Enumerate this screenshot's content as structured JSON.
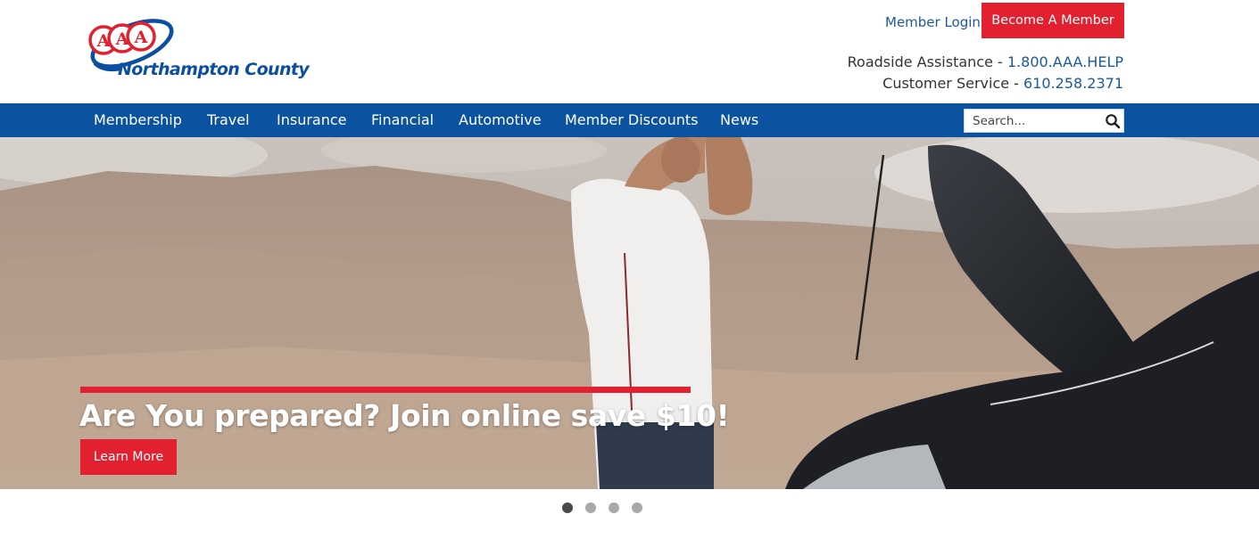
{
  "brand": {
    "logo_letters": "AAA",
    "club_name": "Northampton County",
    "colors": {
      "brand_blue": "#0b52a0",
      "brand_red": "#e3202f",
      "link_blue": "#1a5aa0"
    }
  },
  "header": {
    "member_login": "Member Login",
    "become_member": "Become A Member",
    "roadside_label": "Roadside Assistance - ",
    "roadside_phone": "1.800.AAA.HELP",
    "service_label": "Customer Service - ",
    "service_phone": "610.258.2371"
  },
  "nav": {
    "items": [
      {
        "label": "Membership"
      },
      {
        "label": "Travel"
      },
      {
        "label": "Insurance"
      },
      {
        "label": "Financial"
      },
      {
        "label": "Automotive"
      },
      {
        "label": "Member Discounts"
      },
      {
        "label": "News"
      }
    ],
    "search": {
      "placeholder": "Search...",
      "icon": "search-icon"
    }
  },
  "hero": {
    "headline": "Are You prepared? Join online save $10!",
    "cta": "Learn More"
  },
  "carousel": {
    "slide_count": 4,
    "active_index": 0
  }
}
